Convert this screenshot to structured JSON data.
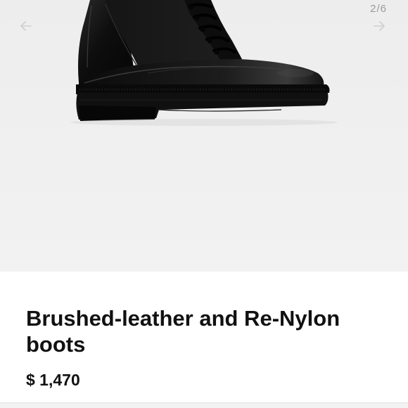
{
  "gallery": {
    "page_indicator": "2/6",
    "image_icon": "boot-product-photo",
    "prev_icon": "arrow-left-icon",
    "next_icon": "arrow-right-icon",
    "background_color": "#efefef"
  },
  "product": {
    "title": "Brushed-leather and Re-Nylon boots",
    "price": "$ 1,470"
  }
}
